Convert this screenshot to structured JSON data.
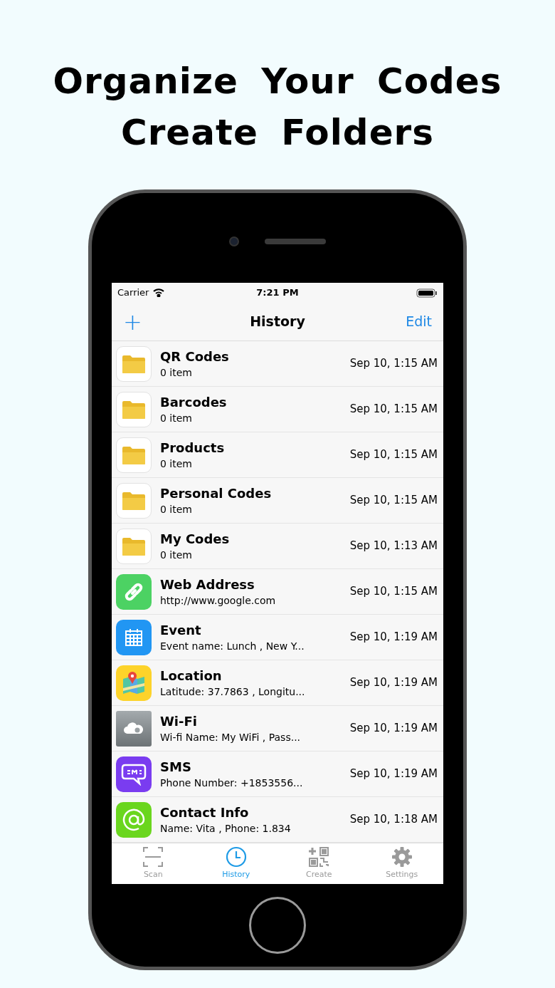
{
  "headline": [
    "Organize Your Codes",
    "Create Folders"
  ],
  "status_bar": {
    "carrier": "Carrier",
    "time": "7:21 PM"
  },
  "nav": {
    "add": "+",
    "title": "History",
    "edit": "Edit"
  },
  "rows": [
    {
      "kind": "folder",
      "title": "QR Codes",
      "subtitle": "0 item",
      "date": "Sep 10, 1:15 AM"
    },
    {
      "kind": "folder",
      "title": "Barcodes",
      "subtitle": "0 item",
      "date": "Sep 10, 1:15 AM"
    },
    {
      "kind": "folder",
      "title": "Products",
      "subtitle": "0 item",
      "date": "Sep 10, 1:15 AM"
    },
    {
      "kind": "folder",
      "title": "Personal Codes",
      "subtitle": "0 item",
      "date": "Sep 10, 1:15 AM"
    },
    {
      "kind": "folder",
      "title": "My Codes",
      "subtitle": "0 item",
      "date": "Sep 10, 1:13 AM"
    },
    {
      "kind": "link",
      "title": "Web Address",
      "subtitle": "http://www.google.com",
      "date": "Sep 10, 1:15 AM"
    },
    {
      "kind": "calendar",
      "title": "Event",
      "subtitle": "Event name: Lunch , New Y...",
      "date": "Sep 10, 1:19 AM"
    },
    {
      "kind": "map",
      "title": "Location",
      "subtitle": "Latitude: 37.7863 , Longitu...",
      "date": "Sep 10, 1:19 AM"
    },
    {
      "kind": "wifi",
      "title": "Wi-Fi",
      "subtitle": "Wi-fi Name: My WiFi  , Pass...",
      "date": "Sep 10, 1:19 AM"
    },
    {
      "kind": "sms",
      "title": "SMS",
      "subtitle": "Phone Number: +1853556...",
      "date": "Sep 10, 1:19 AM"
    },
    {
      "kind": "at",
      "title": "Contact Info",
      "subtitle": "Name: Vita , Phone: 1.834",
      "date": "Sep 10, 1:18 AM"
    }
  ],
  "tabs": [
    {
      "kind": "scan",
      "label": "Scan",
      "selected": false
    },
    {
      "kind": "history",
      "label": "History",
      "selected": true
    },
    {
      "kind": "create",
      "label": "Create",
      "selected": false
    },
    {
      "kind": "settings",
      "label": "Settings",
      "selected": false
    }
  ]
}
